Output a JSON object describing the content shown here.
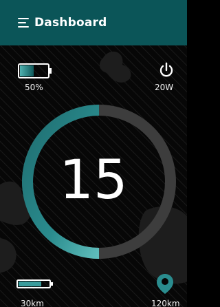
{
  "header": {
    "title": "Dashboard",
    "menu_icon": "hamburger-menu-icon"
  },
  "battery": {
    "icon": "battery-icon",
    "label": "50%",
    "level": 0.5
  },
  "power": {
    "icon": "power-icon",
    "label": "20W"
  },
  "speed": {
    "value": "15",
    "gauge_fraction": 0.5
  },
  "range": {
    "icon": "range-bar-icon",
    "label": "30km",
    "level": 0.75
  },
  "distance": {
    "icon": "location-pin-icon",
    "label": "120km"
  },
  "colors": {
    "header": "#0b5558",
    "accent": "#2a8c8e",
    "accent_dark": "#134f51",
    "track": "#3d3d3d",
    "background": "#050505"
  }
}
